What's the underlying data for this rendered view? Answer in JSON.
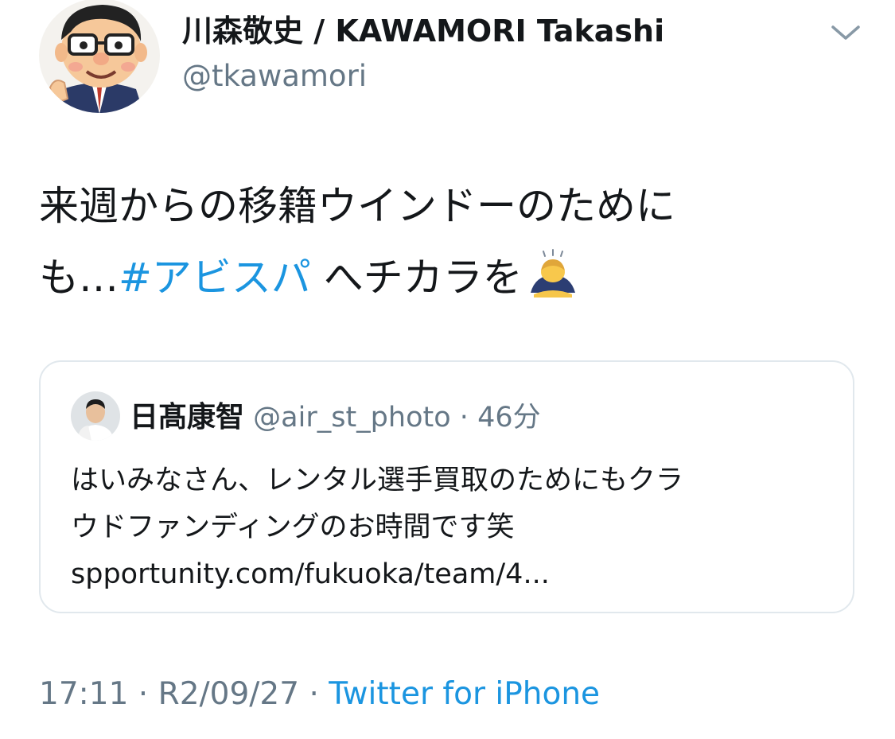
{
  "author": {
    "display_name": "川森敬史 / KAWAMORI Takashi",
    "handle": "@tkawamori"
  },
  "tweet": {
    "line1": "来週からの移籍ウインドーのために",
    "line2_pre": "も…",
    "hashtag": "#アビスパ",
    "line2_post": " へチカラを",
    "emoji": "person-bowing-emoji"
  },
  "quoted_tweet": {
    "name": "日髙康智",
    "handle": "@air_st_photo",
    "separator": "·",
    "time": "46分",
    "line1": "はいみなさん、レンタル選手買取のためにもクラ",
    "line2": "ウドファンディングのお時間です笑",
    "line3": "spportunity.com/fukuoka/team/4..."
  },
  "meta": {
    "time": "17:11",
    "sep1": " · ",
    "date": "R2/09/27",
    "sep2": " · ",
    "source": "Twitter for iPhone"
  },
  "icons": {
    "menu": "chevron-down-icon"
  },
  "colors": {
    "link": "#1b95e0",
    "secondary_text": "#657786",
    "border": "#e1e8ed"
  }
}
